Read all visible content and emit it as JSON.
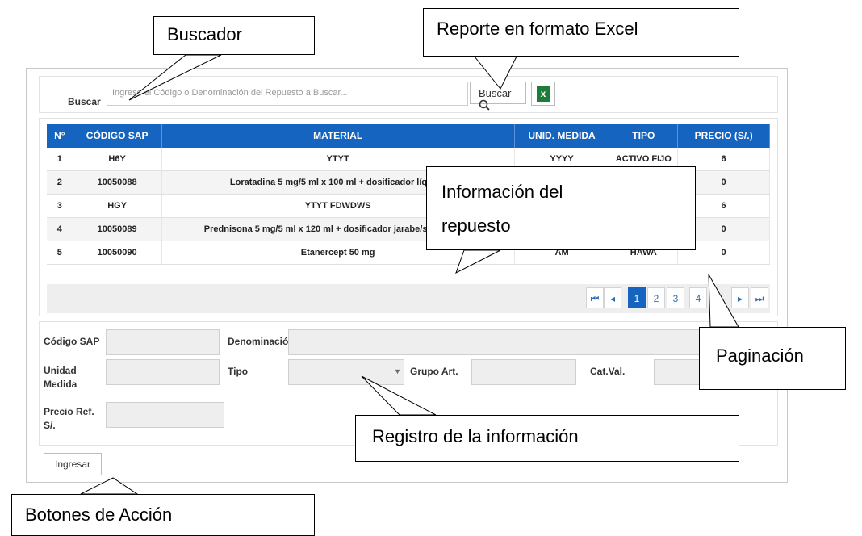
{
  "search": {
    "label": "Buscar",
    "placeholder": "Ingrese el Código o Denominación del Repuesto a Buscar...",
    "button_label": "Buscar",
    "excel_icon_text": "x"
  },
  "table": {
    "headers": [
      "N°",
      "CÓDIGO SAP",
      "MATERIAL",
      "UNID. MEDIDA",
      "TIPO",
      "PRECIO (S/.)"
    ],
    "rows": [
      {
        "n": "1",
        "codigo": "H6Y",
        "material": "YTYT",
        "unidad": "YYYY",
        "tipo": "ACTIVO FIJO",
        "precio": "6"
      },
      {
        "n": "2",
        "codigo": "10050088",
        "material": "Loratadina 5 mg/5 ml x 100 ml + dosificador líquido",
        "unidad": "",
        "tipo": "",
        "precio": "0"
      },
      {
        "n": "3",
        "codigo": "HGY",
        "material": "YTYT FDWDWS",
        "unidad": "",
        "tipo": "",
        "precio": "6"
      },
      {
        "n": "4",
        "codigo": "10050089",
        "material": "Prednisona 5 mg/5 ml x 120 ml + dosificador jarabe/suspensión",
        "unidad": "",
        "tipo": "",
        "precio": "0"
      },
      {
        "n": "5",
        "codigo": "10050090",
        "material": "Etanercept 50 mg",
        "unidad": "AM",
        "tipo": "HAWA",
        "precio": "0"
      }
    ]
  },
  "pagination": {
    "first": "⏮",
    "prev": "◂",
    "pages": [
      "1",
      "2",
      "3",
      "4"
    ],
    "next": "▸",
    "last": "⏭",
    "current": "1"
  },
  "form": {
    "codigo_sap_label": "Código SAP",
    "denominacion_label": "Denominació",
    "unidad_label": "Unidad Medida",
    "tipo_label": "Tipo",
    "grupo_label": "Grupo Art.",
    "catval_label": "Cat.Val.",
    "precio_label": "Precio Ref. S/."
  },
  "actions": {
    "ingresar_label": "Ingresar"
  },
  "callouts": {
    "buscador": "Buscador",
    "reporte": "Reporte en formato Excel",
    "info_line1": "Información del",
    "info_line2": "repuesto",
    "paginacion": "Paginación",
    "registro": "Registro de la información",
    "botones": "Botones de Acción"
  },
  "colors": {
    "header_blue": "#1565c0",
    "excel_green": "#1e7b3a"
  }
}
